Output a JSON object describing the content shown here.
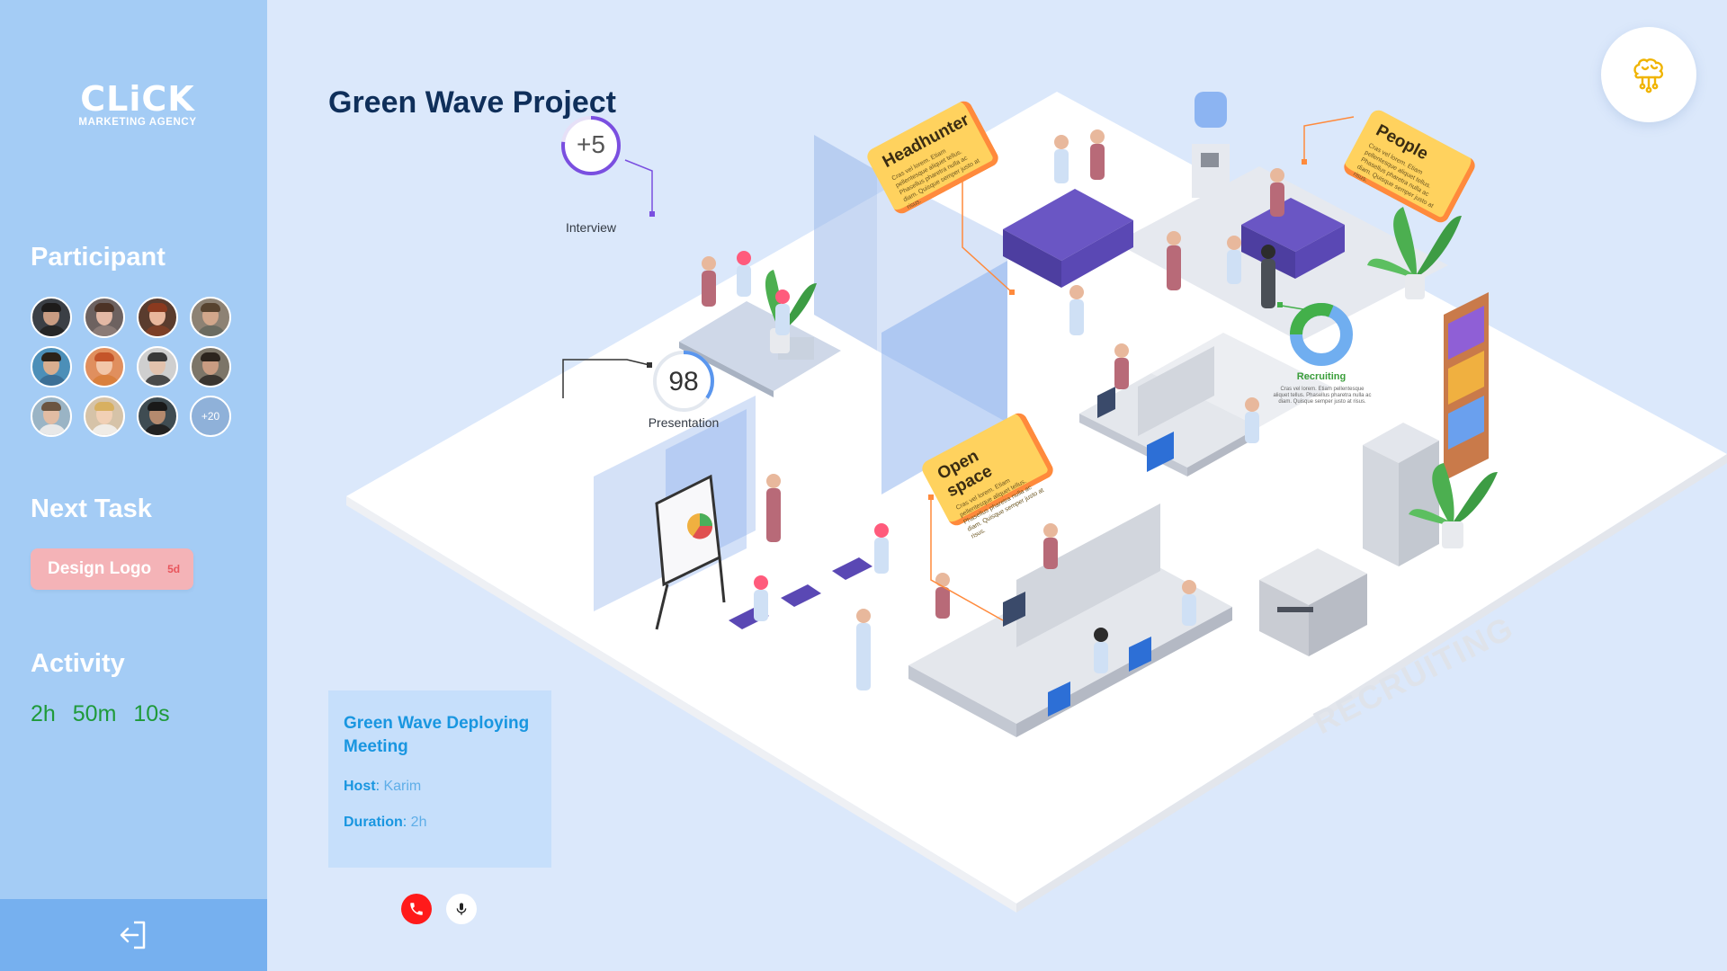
{
  "sidebar": {
    "logo": {
      "brand": "CLiCK",
      "tagline": "MARKETING AGENCY"
    },
    "participant_title": "Participant",
    "participants_more": "+20",
    "next_task_title": "Next Task",
    "task": {
      "label": "Design Logo",
      "due": "5d"
    },
    "activity_title": "Activity",
    "activity": {
      "hours": "2h",
      "minutes": "50m",
      "seconds": "10s"
    }
  },
  "main": {
    "title": "Green Wave Project",
    "meeting": {
      "title": "Green Wave Deploying Meeting",
      "host_label": "Host",
      "host": "Karim",
      "duration_label": "Duration",
      "duration": "2h"
    }
  },
  "scene": {
    "interview_value": "+5",
    "interview_label": "Interview",
    "presentation_value": "98",
    "presentation_label": "Presentation",
    "headhunter": "Headhunter",
    "people": "People",
    "open_space": "Open space",
    "recruiting_label": "Recruiting",
    "recruiting_watermark": "RECRUITING",
    "lorem": "Cras vel lorem. Etiam pellentesque aliquet tellus. Phasellus pharetra nulla ac diam. Quisque semper justo at risus."
  },
  "colors": {
    "sidebar": "#a4ccf5",
    "background": "#dbe8fb",
    "accent_green": "#1f9a3a",
    "accent_blue": "#1996e0",
    "call_red": "#ff1a1a",
    "callout_yellow": "#ffd25e",
    "callout_orange": "#ff8a3c",
    "ring_purple": "#7a4fe0"
  }
}
